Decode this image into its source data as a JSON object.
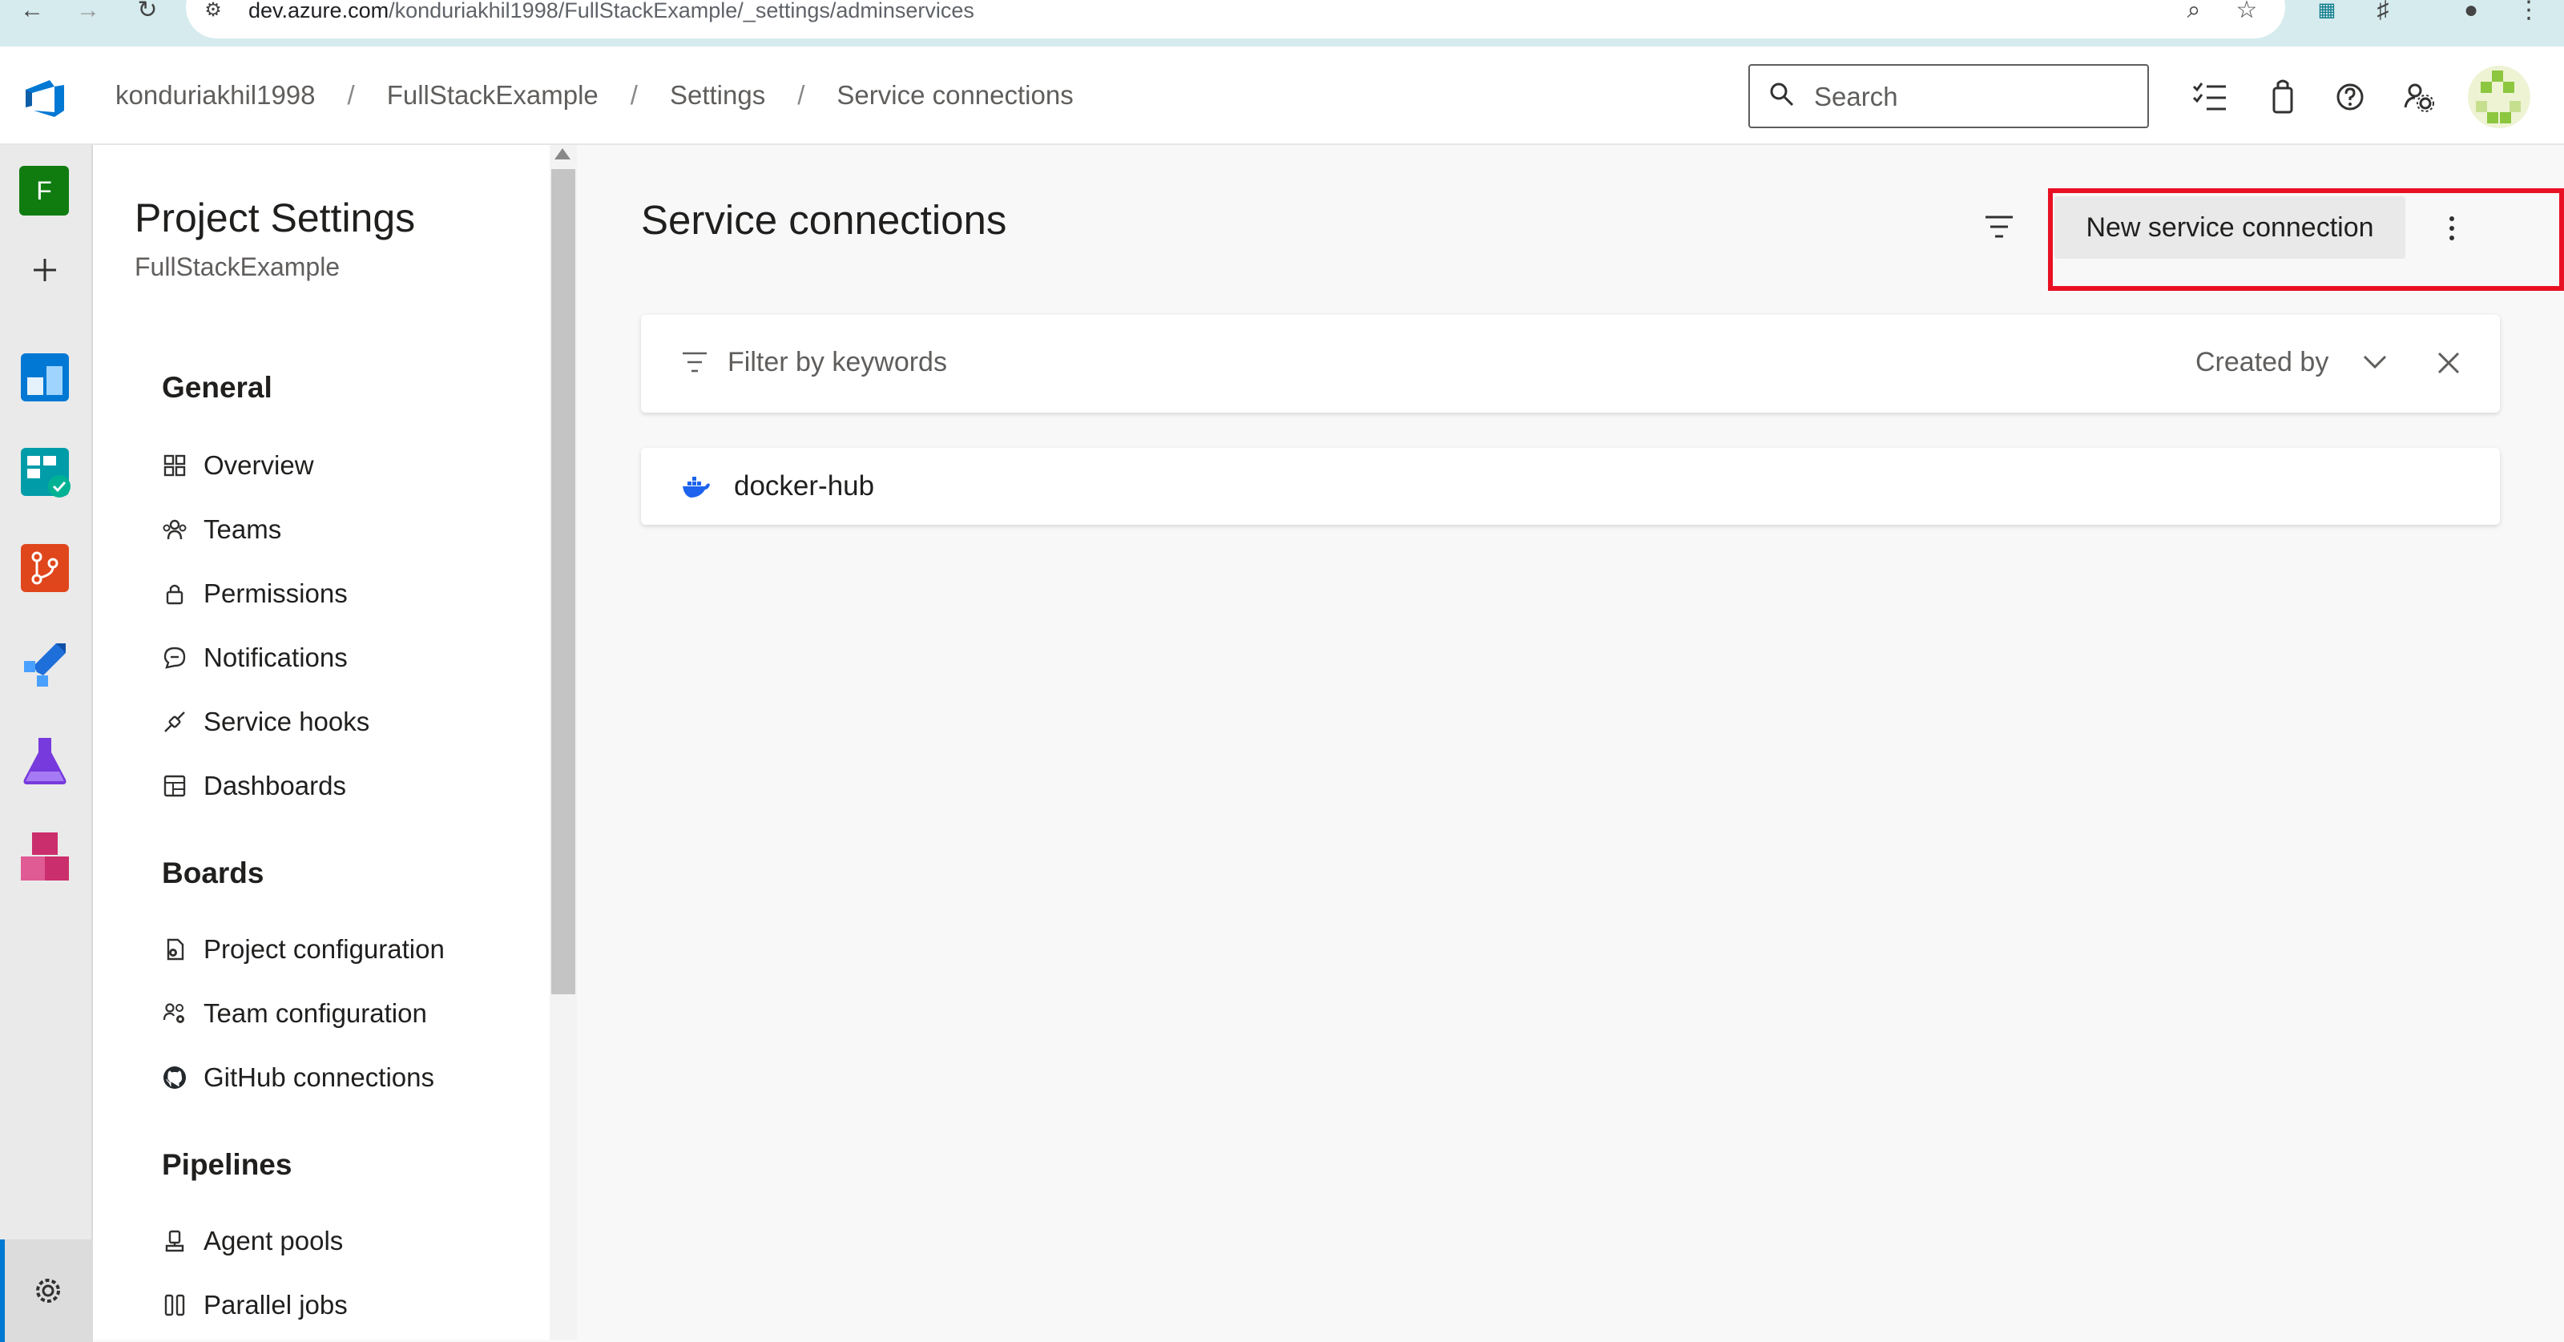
{
  "browser": {
    "url_host": "dev.azure.com",
    "url_path": "/konduriakhil1998/FullStackExample/_settings/adminservices"
  },
  "header": {
    "breadcrumb": [
      "konduriakhil1998",
      "FullStackExample",
      "Settings",
      "Service connections"
    ],
    "separator": "/",
    "search_placeholder": "Search"
  },
  "rail": {
    "project_initial": "F",
    "items": [
      "add",
      "overview",
      "boards",
      "repos",
      "pipelines",
      "test-plans",
      "artifacts",
      "project-settings"
    ]
  },
  "sidebar": {
    "title": "Project Settings",
    "subtitle": "FullStackExample",
    "sections": [
      {
        "label": "General",
        "items": [
          {
            "label": "Overview",
            "icon": "overview-icon"
          },
          {
            "label": "Teams",
            "icon": "teams-icon"
          },
          {
            "label": "Permissions",
            "icon": "lock-icon"
          },
          {
            "label": "Notifications",
            "icon": "chat-icon"
          },
          {
            "label": "Service hooks",
            "icon": "plug-icon"
          },
          {
            "label": "Dashboards",
            "icon": "dashboard-icon"
          }
        ]
      },
      {
        "label": "Boards",
        "items": [
          {
            "label": "Project configuration",
            "icon": "doc-gear-icon"
          },
          {
            "label": "Team configuration",
            "icon": "people-gear-icon"
          },
          {
            "label": "GitHub connections",
            "icon": "github-icon"
          }
        ]
      },
      {
        "label": "Pipelines",
        "items": [
          {
            "label": "Agent pools",
            "icon": "agent-pool-icon"
          },
          {
            "label": "Parallel jobs",
            "icon": "parallel-jobs-icon"
          }
        ]
      }
    ]
  },
  "main": {
    "title": "Service connections",
    "new_button": "New service connection",
    "filter_placeholder": "Filter by keywords",
    "created_by": "Created by",
    "connections": [
      {
        "name": "docker-hub",
        "icon": "docker-icon"
      }
    ]
  },
  "colors": {
    "accent": "#0078d4",
    "highlight": "#e81123",
    "project_tile": "#107c10"
  }
}
